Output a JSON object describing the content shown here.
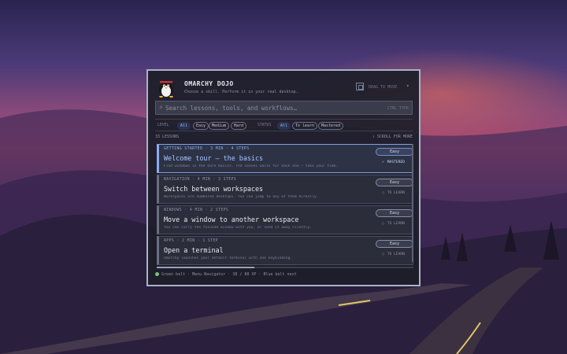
{
  "header": {
    "title": "OMARCHY DOJO",
    "subtitle": "Choose a skill. Perform it in your real desktop.",
    "drag_label": "DRAG TO MOVE",
    "drag_caret": "▾"
  },
  "search": {
    "placeholder": "Search lessons, tools, and workflows…",
    "shortcut": "CTRL TYPE"
  },
  "filters": {
    "level_label": "LEVEL",
    "levels": [
      "All",
      "Easy",
      "Medium",
      "Hard"
    ],
    "status_label": "STATUS",
    "statuses": [
      "All",
      "To learn",
      "Mastered"
    ],
    "active_level": "All",
    "active_status": "All"
  },
  "list": {
    "count": "33 LESSONS",
    "scroll_hint": "SCROLL FOR MORE",
    "lessons": [
      {
        "meta": "GETTING STARTED · 3 MIN · 4 STEPS",
        "title": "Welcome tour — the basics",
        "description": "Find windows in the bare basics. The sensei waits for each one — take your time.",
        "difficulty": "Easy",
        "status_mark": "✓",
        "status": "MASTERED",
        "selected": true
      },
      {
        "meta": "NAVIGATION · 4 MIN · 3 STEPS",
        "title": "Switch between workspaces",
        "description": "Workspaces are numbered desktops. You can jump to any of them directly.",
        "difficulty": "Easy",
        "status_mark": "○",
        "status": "TO LEARN",
        "selected": false
      },
      {
        "meta": "WINDOWS · 4 MIN · 2 STEPS",
        "title": "Move a window to another workspace",
        "description": "You can carry the focused window with you, or send it away silently.",
        "difficulty": "Easy",
        "status_mark": "○",
        "status": "TO LEARN",
        "selected": false
      },
      {
        "meta": "APPS · 2 MIN · 1 STEP",
        "title": "Open a terminal",
        "description": "Omarchy launches your default terminal with one keybinding.",
        "difficulty": "Easy",
        "status_mark": "○",
        "status": "TO LEARN",
        "selected": false
      }
    ]
  },
  "progress": {
    "fraction": 0.38
  },
  "footer": {
    "text": "Green belt · Menu Navigator · 38 / 88 XP · Blue belt next"
  },
  "colors": {
    "accent": "#8aaaf0",
    "belt": "#7ec07a",
    "panel_border": "#a9b2c8"
  }
}
